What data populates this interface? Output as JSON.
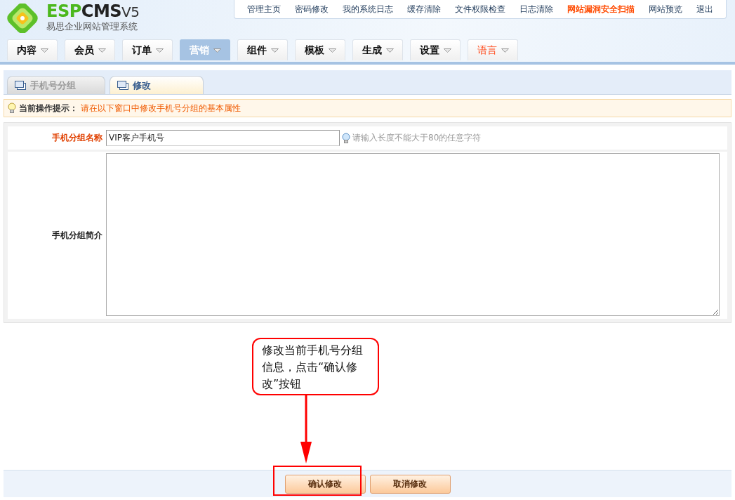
{
  "logo": {
    "brand_accent": "ESP",
    "brand": "CMS",
    "version": "V5",
    "subtitle": "易思企业网站管理系统"
  },
  "top_links": [
    {
      "label": "管理主页",
      "highlight": false
    },
    {
      "label": "密码修改",
      "highlight": false
    },
    {
      "label": "我的系统日志",
      "highlight": false
    },
    {
      "label": "缓存清除",
      "highlight": false
    },
    {
      "label": "文件权限检查",
      "highlight": false
    },
    {
      "label": "日志清除",
      "highlight": false
    },
    {
      "label": "网站漏洞安全扫描",
      "highlight": true
    },
    {
      "label": "网站预览",
      "highlight": false
    },
    {
      "label": "退出",
      "highlight": false
    }
  ],
  "nav_tabs": [
    {
      "label": "内容",
      "selected": false,
      "highlight": false
    },
    {
      "label": "会员",
      "selected": false,
      "highlight": false
    },
    {
      "label": "订单",
      "selected": false,
      "highlight": false
    },
    {
      "label": "营销",
      "selected": true,
      "highlight": false
    },
    {
      "label": "组件",
      "selected": false,
      "highlight": false
    },
    {
      "label": "模板",
      "selected": false,
      "highlight": false
    },
    {
      "label": "生成",
      "selected": false,
      "highlight": false
    },
    {
      "label": "设置",
      "selected": false,
      "highlight": false
    },
    {
      "label": "语言",
      "selected": false,
      "highlight": true
    }
  ],
  "sub_tabs": [
    {
      "label": "手机号分组",
      "selected": false
    },
    {
      "label": "修改",
      "selected": true
    }
  ],
  "hint": {
    "label": "当前操作提示：",
    "text": "请在以下窗口中修改手机号分组的基本属性"
  },
  "form": {
    "name_field": {
      "label": "手机分组名称",
      "value": "VIP客户手机号",
      "help": "请输入长度不能大于80的任意字符"
    },
    "description_field": {
      "label": "手机分组简介"
    }
  },
  "buttons": [
    {
      "label": "确认修改",
      "highlighted": true
    },
    {
      "label": "取消修改",
      "highlighted": false
    }
  ],
  "callout": {
    "text": "修改当前手机号分组信息，点击“确认修改”按钮"
  }
}
